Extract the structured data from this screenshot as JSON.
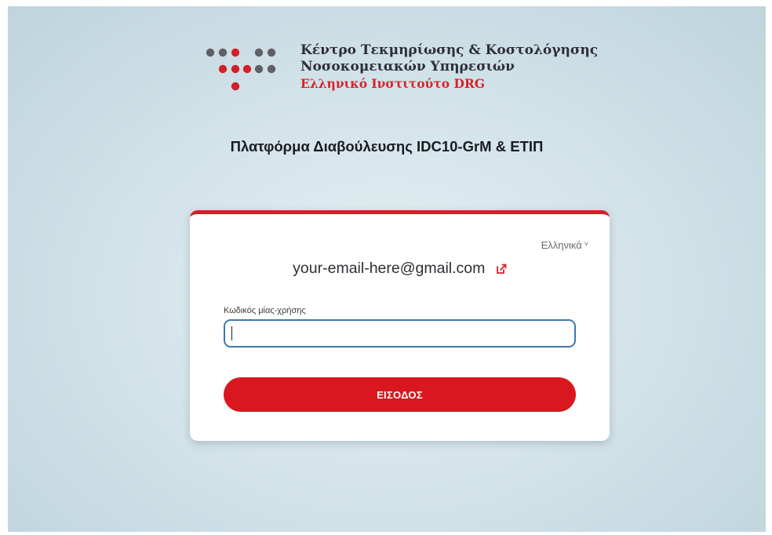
{
  "header": {
    "logo_line1": "Κέντρο Τεκμηρίωσης & Κοστολόγησης",
    "logo_line2": "Νοσοκομειακών Υπηρεσιών",
    "logo_line3": "Ελληνικό Ινστιτούτο DRG",
    "platform_title": "Πλατφόρμα Διαβούλευσης IDC10-GrM & ΕΤΙΠ"
  },
  "login": {
    "language": "Ελληνικά",
    "email": "your-email-here@gmail.com",
    "otp_label": "Κωδικός μίας-χρήσης",
    "otp_value": "",
    "submit_label": "ΕΙΣΟΔΟΣ"
  },
  "colors": {
    "brand_red": "#d9171f",
    "logo_gray": "#5f5f66",
    "input_border": "#3d78ad"
  },
  "icons": {
    "edit_email": "edit-external-icon",
    "language_dropdown": "chevron-down-icon"
  }
}
